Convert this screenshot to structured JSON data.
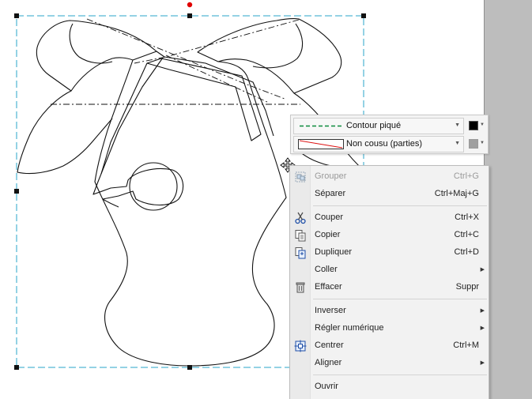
{
  "properties": {
    "outline_label": "Contour piqué",
    "outline_color": "#000000",
    "fill_label": "Non cousu (parties)",
    "fill_color": "#a0a0a0"
  },
  "colors": {
    "selection": "#2aa6c8",
    "rotation_handle": "#e00000",
    "outline_swatch": "#0a8a3c",
    "fill_swatch_line": "#d11"
  },
  "menu": {
    "items": [
      {
        "label": "Grouper",
        "shortcut": "Ctrl+G",
        "icon": "group-icon",
        "enabled": false
      },
      {
        "label": "Séparer",
        "shortcut": "Ctrl+Maj+G",
        "icon": "",
        "enabled": true
      },
      {
        "label": "Couper",
        "shortcut": "Ctrl+X",
        "icon": "scissors-icon",
        "enabled": true
      },
      {
        "label": "Copier",
        "shortcut": "Ctrl+C",
        "icon": "copy-icon",
        "enabled": true
      },
      {
        "label": "Dupliquer",
        "shortcut": "Ctrl+D",
        "icon": "duplicate-icon",
        "enabled": true
      },
      {
        "label": "Coller",
        "shortcut": "",
        "icon": "",
        "enabled": true,
        "submenu": true
      },
      {
        "label": "Effacer",
        "shortcut": "Suppr",
        "icon": "trash-icon",
        "enabled": true
      },
      {
        "label": "Inverser",
        "shortcut": "",
        "icon": "",
        "enabled": true,
        "submenu": true
      },
      {
        "label": "Régler numérique",
        "shortcut": "",
        "icon": "",
        "enabled": true,
        "submenu": true
      },
      {
        "label": "Centrer",
        "shortcut": "Ctrl+M",
        "icon": "center-icon",
        "enabled": true
      },
      {
        "label": "Aligner",
        "shortcut": "",
        "icon": "",
        "enabled": true,
        "submenu": true
      },
      {
        "label": "Ouvrir",
        "shortcut": "",
        "icon": "",
        "enabled": true
      }
    ]
  }
}
